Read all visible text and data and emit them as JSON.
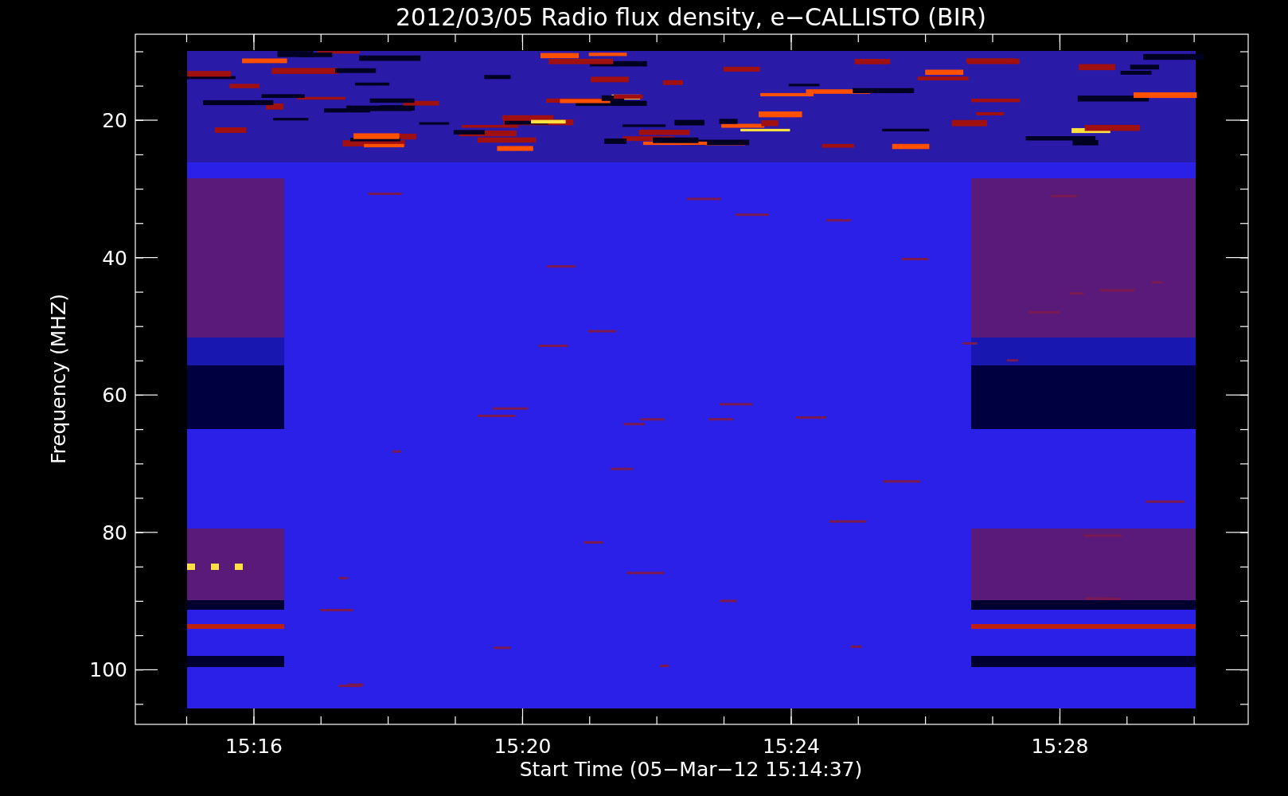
{
  "title": "2012/03/05  Radio flux density, e−CALLISTO (BIR)",
  "x_axis": {
    "label": "Start Time (05−Mar−12 15:14:37)",
    "ticks": [
      "15:16",
      "15:20",
      "15:24",
      "15:28"
    ]
  },
  "y_axis": {
    "label": "Frequency (MHZ)",
    "ticks": [
      "20",
      "40",
      "60",
      "80",
      "100"
    ]
  }
}
